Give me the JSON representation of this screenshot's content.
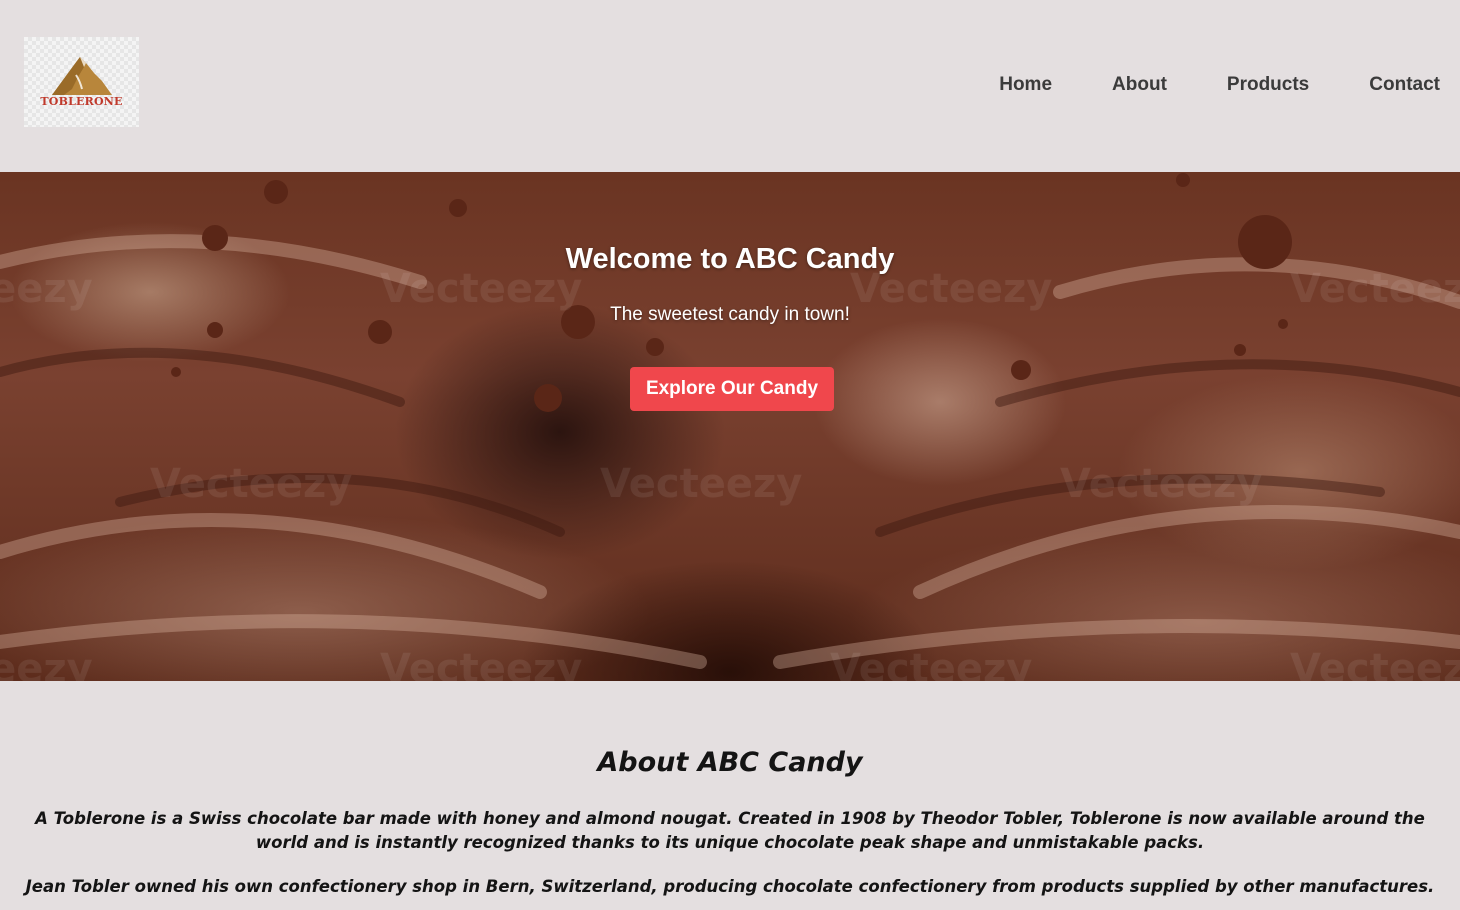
{
  "header": {
    "logo_text": "TOBLERONE",
    "nav": [
      "Home",
      "About",
      "Products",
      "Contact"
    ]
  },
  "hero": {
    "title": "Welcome to ABC Candy",
    "subtitle": "The sweetest candy in town!",
    "button_label": "Explore Our Candy",
    "watermark": "Vecteezy"
  },
  "about": {
    "heading": "About ABC Candy",
    "paragraph1": "A Toblerone is a Swiss chocolate bar made with honey and almond nougat. Created in 1908 by Theodor Tobler, Toblerone is now available around the world and is instantly recognized thanks to its unique chocolate peak shape and unmistakable packs.",
    "paragraph2": "Jean Tobler owned his own confectionery shop in Bern, Switzerland, producing chocolate confectionery from products supplied by other manufactures."
  },
  "colors": {
    "background": "#e4dfe0",
    "button": "#f0474c",
    "nav_text": "#3b3b3b",
    "logo_red": "#c0392b",
    "logo_gold": "#b8863b"
  }
}
